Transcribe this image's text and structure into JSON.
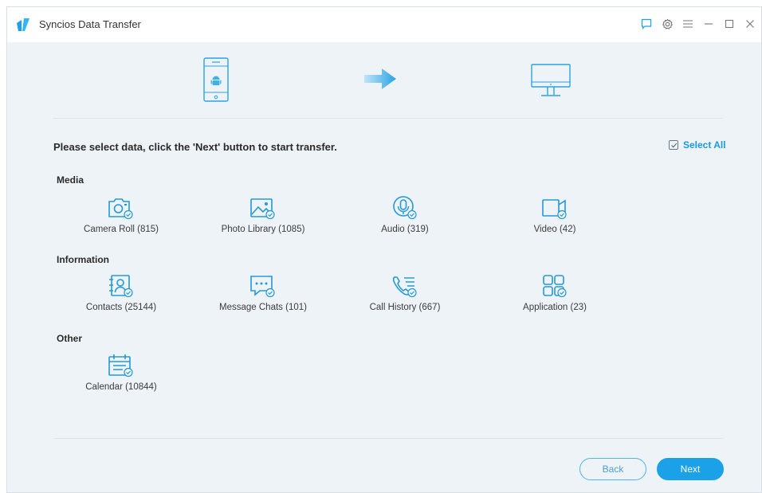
{
  "window": {
    "title": "Syncios Data Transfer"
  },
  "titlebar_controls": [
    {
      "name": "feedback-icon"
    },
    {
      "name": "settings-icon"
    },
    {
      "name": "menu-icon"
    },
    {
      "name": "minimize-icon"
    },
    {
      "name": "maximize-icon"
    },
    {
      "name": "close-icon"
    }
  ],
  "transfer": {
    "source_icon": "android-phone-icon",
    "direction_icon": "arrow-right-icon",
    "target_icon": "computer-monitor-icon"
  },
  "instruction": "Please select data, click the 'Next' button to start transfer.",
  "select_all_label": "Select All",
  "sections": {
    "media": {
      "title": "Media",
      "items": [
        {
          "label": "Camera Roll (815)",
          "icon": "camera-icon"
        },
        {
          "label": "Photo Library (1085)",
          "icon": "photo-icon"
        },
        {
          "label": "Audio (319)",
          "icon": "audio-icon"
        },
        {
          "label": "Video (42)",
          "icon": "video-icon"
        }
      ]
    },
    "information": {
      "title": "Information",
      "items": [
        {
          "label": "Contacts (25144)",
          "icon": "contacts-icon"
        },
        {
          "label": "Message Chats (101)",
          "icon": "message-icon"
        },
        {
          "label": "Call History (667)",
          "icon": "call-history-icon"
        },
        {
          "label": "Application (23)",
          "icon": "application-icon"
        }
      ]
    },
    "other": {
      "title": "Other",
      "items": [
        {
          "label": "Calendar (10844)",
          "icon": "calendar-icon"
        }
      ]
    }
  },
  "buttons": {
    "back": "Back",
    "next": "Next"
  },
  "colors": {
    "accent": "#1aa1e8",
    "icon": "#2399d8",
    "background": "#eef3f8",
    "titlebar": "#ffffff"
  }
}
